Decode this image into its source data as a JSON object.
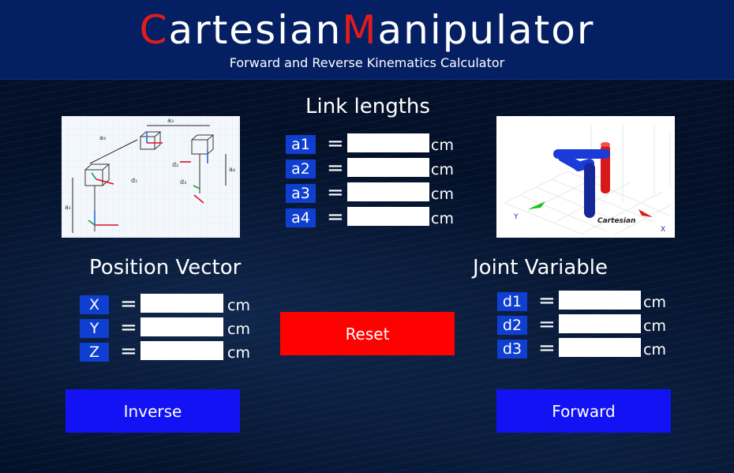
{
  "header": {
    "title_c": "C",
    "title_artesian": "artesian",
    "title_m": "M",
    "title_anipulator": "anipulator",
    "subtitle": "Forward and Reverse Kinematics Calculator"
  },
  "link_lengths": {
    "title": "Link lengths",
    "rows": [
      {
        "label": "a1",
        "value": "",
        "unit": "cm"
      },
      {
        "label": "a2",
        "value": "",
        "unit": "cm"
      },
      {
        "label": "a3",
        "value": "",
        "unit": "cm"
      },
      {
        "label": "a4",
        "value": "",
        "unit": "cm"
      }
    ]
  },
  "position_vector": {
    "title": "Position Vector",
    "rows": [
      {
        "label": "X",
        "value": "",
        "unit": "cm"
      },
      {
        "label": "Y",
        "value": "",
        "unit": "cm"
      },
      {
        "label": "Z",
        "value": "",
        "unit": "cm"
      }
    ]
  },
  "joint_variable": {
    "title": "Joint Variable",
    "rows": [
      {
        "label": "d1",
        "value": "",
        "unit": "cm"
      },
      {
        "label": "d2",
        "value": "",
        "unit": "cm"
      },
      {
        "label": "d3",
        "value": "",
        "unit": "cm"
      }
    ]
  },
  "buttons": {
    "reset": "Reset",
    "inverse": "Inverse",
    "forward": "Forward"
  },
  "symbols": {
    "equals": "="
  },
  "robot_image": {
    "caption": "Cartesian",
    "axis_y": "Y",
    "axis_x": "X"
  },
  "diagram_image": {
    "labels": [
      "a3",
      "a2",
      "a4",
      "a1",
      "d1",
      "d2",
      "d3"
    ]
  },
  "colors": {
    "header_bg": "#051f63",
    "accent_red": "#fe0101",
    "accent_blue": "#1212f5",
    "label_blue": "#0f3fd0"
  }
}
